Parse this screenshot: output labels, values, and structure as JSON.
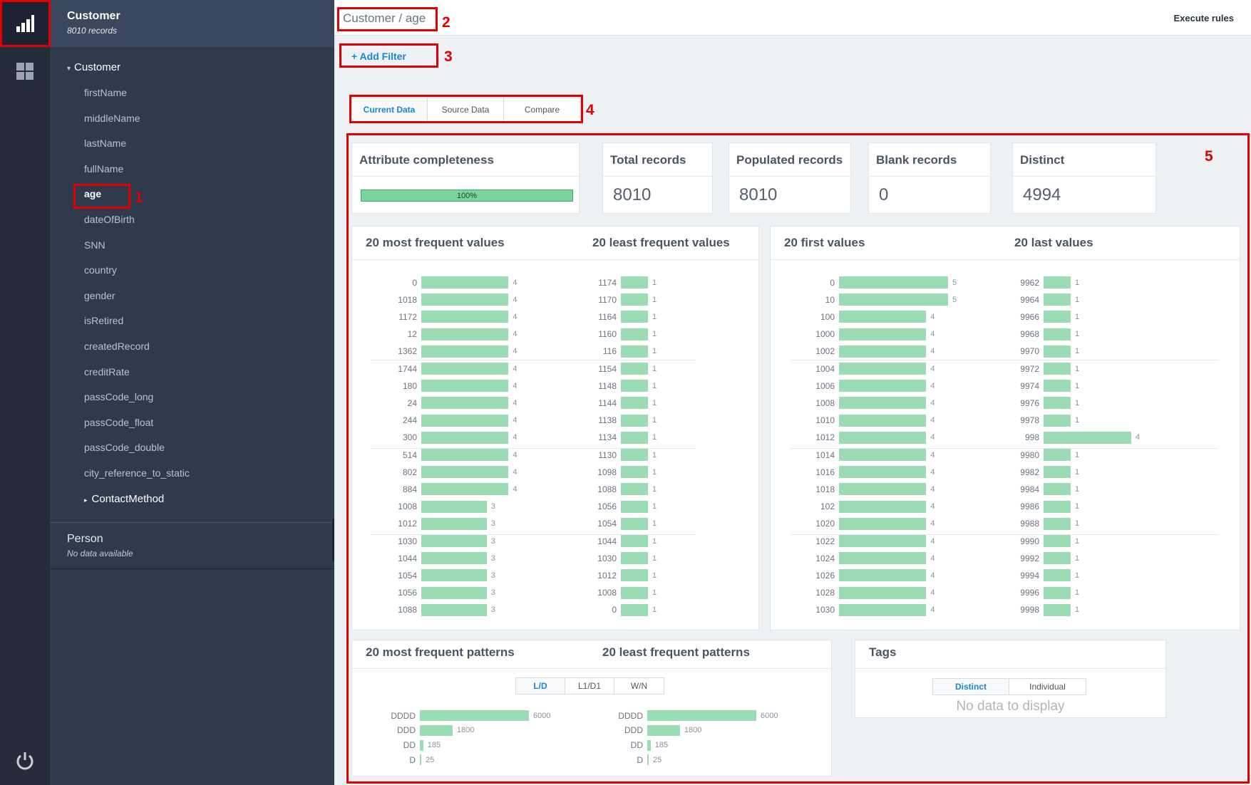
{
  "sidebar": {
    "entity_title": "Customer",
    "entity_records": "8010 records",
    "tree_root": "Customer",
    "items": [
      "firstName",
      "middleName",
      "lastName",
      "fullName",
      "age",
      "dateOfBirth",
      "SNN",
      "country",
      "gender",
      "isRetired",
      "createdRecord",
      "creditRate",
      "passCode_long",
      "passCode_float",
      "passCode_double",
      "city_reference_to_static"
    ],
    "selected": "age",
    "subgroup": "ContactMethod",
    "person_title": "Person",
    "person_sub": "No data available"
  },
  "header": {
    "breadcrumb": "Customer / age",
    "execute": "Execute rules"
  },
  "filter": {
    "add_label": "+ Add Filter"
  },
  "tabs": [
    "Current Data",
    "Source Data",
    "Compare"
  ],
  "annotations": [
    "1",
    "2",
    "3",
    "4",
    "5"
  ],
  "stats": {
    "completeness_title": "Attribute completeness",
    "completeness_value": "100%",
    "completeness_fraction": 1.0,
    "total_title": "Total records",
    "total_value": "8010",
    "populated_title": "Populated records",
    "populated_value": "8010",
    "blank_title": "Blank records",
    "blank_value": "0",
    "distinct_title": "Distinct",
    "distinct_value": "4994"
  },
  "panels": {
    "most_frequent": "20 most frequent values",
    "least_frequent": "20 least frequent values",
    "first_values": "20 first values",
    "last_values": "20 last values",
    "most_patterns": "20 most frequent patterns",
    "least_patterns": "20 least frequent patterns",
    "tags": "Tags",
    "tags_empty": "No data to display",
    "pattern_modes": [
      "L/D",
      "L1/D1",
      "W/N"
    ],
    "tag_modes": [
      "Distinct",
      "Individual"
    ]
  },
  "chart_data": [
    {
      "type": "bar",
      "name": "most_frequent",
      "categories": [
        "0",
        "1018",
        "1172",
        "12",
        "1362",
        "1744",
        "180",
        "24",
        "244",
        "300",
        "514",
        "802",
        "884",
        "1008",
        "1012",
        "1030",
        "1044",
        "1054",
        "1056",
        "1088"
      ],
      "values": [
        4,
        4,
        4,
        4,
        4,
        4,
        4,
        4,
        4,
        4,
        4,
        4,
        4,
        3,
        3,
        3,
        3,
        3,
        3,
        3
      ]
    },
    {
      "type": "bar",
      "name": "least_frequent",
      "categories": [
        "1174",
        "1170",
        "1164",
        "1160",
        "116",
        "1154",
        "1148",
        "1144",
        "1138",
        "1134",
        "1130",
        "1098",
        "1088",
        "1056",
        "1054",
        "1044",
        "1030",
        "1012",
        "1008",
        "0"
      ],
      "values": [
        1,
        1,
        1,
        1,
        1,
        1,
        1,
        1,
        1,
        1,
        1,
        1,
        1,
        1,
        1,
        1,
        1,
        1,
        1,
        1
      ]
    },
    {
      "type": "bar",
      "name": "first_values",
      "categories": [
        "0",
        "10",
        "100",
        "1000",
        "1002",
        "1004",
        "1006",
        "1008",
        "1010",
        "1012",
        "1014",
        "1016",
        "1018",
        "102",
        "1020",
        "1022",
        "1024",
        "1026",
        "1028",
        "1030"
      ],
      "values": [
        5,
        5,
        4,
        4,
        4,
        4,
        4,
        4,
        4,
        4,
        4,
        4,
        4,
        4,
        4,
        4,
        4,
        4,
        4,
        4
      ]
    },
    {
      "type": "bar",
      "name": "last_values",
      "categories": [
        "9962",
        "9964",
        "9966",
        "9968",
        "9970",
        "9972",
        "9974",
        "9976",
        "9978",
        "998",
        "9980",
        "9982",
        "9984",
        "9986",
        "9988",
        "9990",
        "9992",
        "9994",
        "9996",
        "9998"
      ],
      "values": [
        1,
        1,
        1,
        1,
        1,
        1,
        1,
        1,
        1,
        4,
        1,
        1,
        1,
        1,
        1,
        1,
        1,
        1,
        1,
        1
      ]
    },
    {
      "type": "bar",
      "name": "most_patterns",
      "categories": [
        "DDDD",
        "DDD",
        "DD",
        "D"
      ],
      "values": [
        6000,
        1800,
        185,
        25
      ]
    },
    {
      "type": "bar",
      "name": "least_patterns",
      "categories": [
        "DDDD",
        "DDD",
        "DD",
        "D"
      ],
      "values": [
        6000,
        1800,
        185,
        25
      ]
    }
  ]
}
